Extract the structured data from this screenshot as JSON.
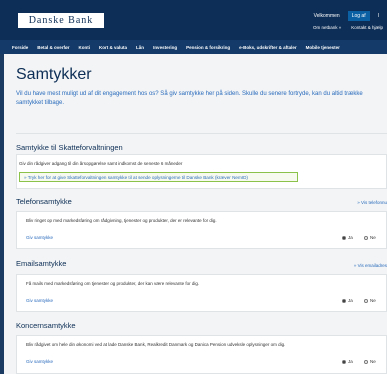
{
  "header": {
    "logo": "Danske Bank",
    "top_links": [
      "Velkommen",
      "Log af",
      "I"
    ],
    "sub_links": [
      "Om netbank »",
      "Kontakt & hjælp"
    ],
    "nav": [
      "Forside",
      "Betal & overfør",
      "Konti",
      "Kort & valuta",
      "Lån",
      "Investering",
      "Pension & forsikring",
      "e-Boks, udskrifter & aftaler",
      "Mobile tjenester"
    ]
  },
  "page": {
    "title": "Samtykker",
    "intro": "Vil du have mest muligt ud af dit engagement hos os? Så giv samtykke her på siden. Skulle du senere fortryde, kan du altid trække samtykket tilbage."
  },
  "skat": {
    "title": "Samtykke til Skatteforvaltningen",
    "line1": "Giv din rådgiver adgang til din årsopgørelse samt indkomst de seneste 6 måneder",
    "link": "» Tryk her for at give Skatteforvaltningen samtykke til at sende oplysningerne til Danske Bank (kræver NemID)"
  },
  "telefon": {
    "title": "Telefonsamtykke",
    "right_link": "» Vis telefonnu",
    "text": "Bliv ringet op med markedsføring om rådgivning, tjenester og produkter, der er relevante for dig.",
    "consent": "Giv samtykke",
    "yes": "Ja",
    "no": "Ne"
  },
  "email": {
    "title": "Emailsamtykke",
    "right_link": "» Vis emailadres",
    "text": "Få mails med markedsføring om tjenester og produkter, der kan være relevante for dig.",
    "consent": "Giv samtykke",
    "yes": "Ja",
    "no": "Ne"
  },
  "koncern": {
    "title": "Koncernsamtykke",
    "text": "Bliv rådgivet om hele din økonomi ved at lade Danske Bank, Realkredit Danmark og Danica Pension udveksle oplysninger om dig.",
    "consent": "Giv samtykke",
    "yes": "Ja",
    "no": "Ne"
  }
}
